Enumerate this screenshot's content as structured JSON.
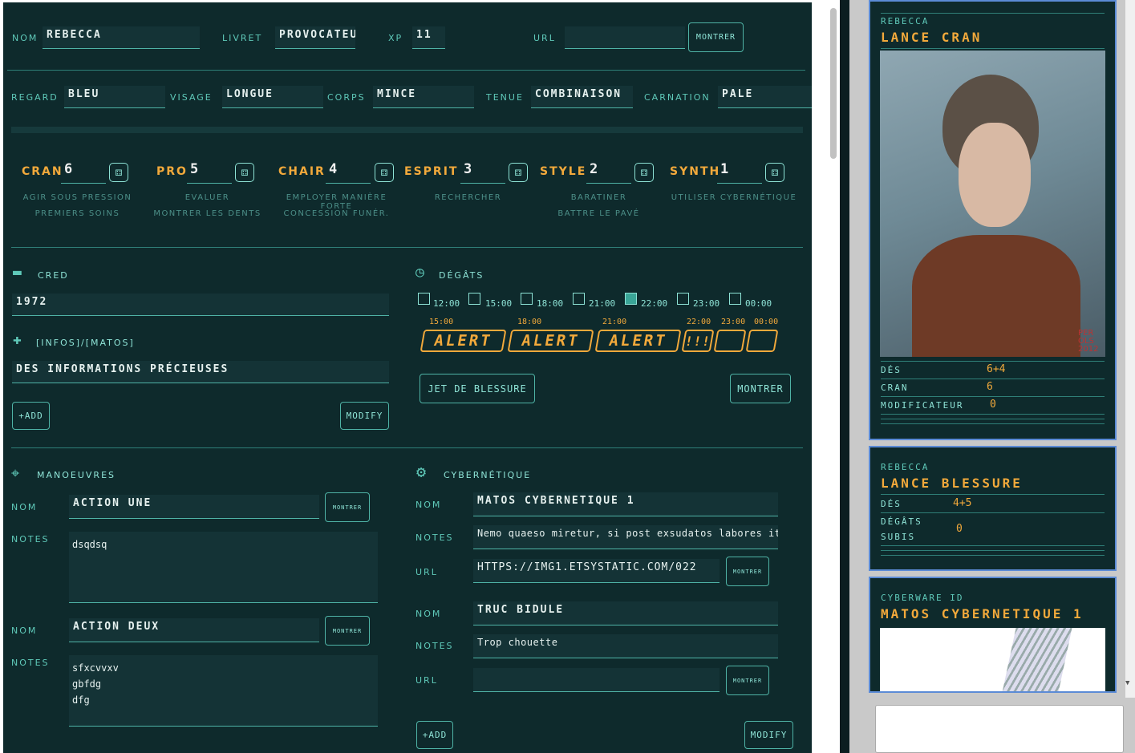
{
  "header": {
    "nom_label": "NOM",
    "nom": "REBECCA",
    "livret_label": "LIVRET",
    "livret": "PROVOCATEU",
    "xp_label": "XP",
    "xp": "11",
    "url_label": "URL",
    "url": "",
    "montrer": "MONTRER"
  },
  "look": {
    "regard_label": "REGARD",
    "regard": "BLEU",
    "visage_label": "VISAGE",
    "visage": "LONGUE",
    "corps_label": "CORPS",
    "corps": "MINCE",
    "tenue_label": "TENUE",
    "tenue": "COMBINAISON",
    "carnation_label": "CARNATION",
    "carnation": "PALE"
  },
  "stats": [
    {
      "name": "CRAN",
      "value": "6",
      "skills": [
        "AGIR SOUS PRESSION",
        "PREMIERS SOINS"
      ]
    },
    {
      "name": "PRO",
      "value": "5",
      "skills": [
        "EVALUER",
        "MONTRER LES DENTS"
      ]
    },
    {
      "name": "CHAIR",
      "value": "4",
      "skills": [
        "EMPLOYER MANIÈRE FORTE",
        "CONCESSION FUNÉR."
      ]
    },
    {
      "name": "ESPRIT",
      "value": "3",
      "skills": [
        "RECHERCHER",
        ""
      ]
    },
    {
      "name": "STYLE",
      "value": "2",
      "skills": [
        "BARATINER",
        "BATTRE LE PAVÉ"
      ]
    },
    {
      "name": "SYNTH",
      "value": "1",
      "skills": [
        "UTILISER CYBERNÉTIQUE",
        ""
      ]
    }
  ],
  "cred": {
    "title": "CRED",
    "value": "1972"
  },
  "infos": {
    "title": "[INFOS]/[MATOS]",
    "value": "DES INFORMATIONS PRÉCIEUSES",
    "add": "+ADD",
    "modify": "MODIFY"
  },
  "degats": {
    "title": "DÉGÂTS",
    "checks": [
      {
        "time": "12:00",
        "on": false
      },
      {
        "time": "15:00",
        "on": false
      },
      {
        "time": "18:00",
        "on": false
      },
      {
        "time": "21:00",
        "on": false
      },
      {
        "time": "22:00",
        "on": true
      },
      {
        "time": "23:00",
        "on": false
      },
      {
        "time": "00:00",
        "on": false
      }
    ],
    "alerts": [
      {
        "time": "15:00",
        "text": "ALERT"
      },
      {
        "time": "18:00",
        "text": "ALERT"
      },
      {
        "time": "21:00",
        "text": "ALERT"
      },
      {
        "time": "22:00",
        "text": "!!!"
      },
      {
        "time": "23:00",
        "text": ""
      },
      {
        "time": "00:00",
        "text": ""
      }
    ],
    "jet": "JET DE BLESSURE",
    "montrer": "MONTRER"
  },
  "manoeuvres": {
    "title": "MANOEUVRES",
    "nom_label": "NOM",
    "notes_label": "NOTES",
    "montrer": "MONTRER",
    "items": [
      {
        "nom": "ACTION UNE",
        "notes": "dsqdsq"
      },
      {
        "nom": "ACTION DEUX",
        "notes": "sfxcvvxv\ngbfdg\ndfg"
      }
    ]
  },
  "cyber": {
    "title": "CYBERNÉTIQUE",
    "nom_label": "NOM",
    "notes_label": "NOTES",
    "url_label": "URL",
    "montrer": "MONTRER",
    "add": "+ADD",
    "modify": "MODIFY",
    "items": [
      {
        "nom": "MATOS CYBERNETIQUE 1",
        "notes": "Nemo quaeso miretur, si post exsudatos labores iti",
        "url": "HTTPS://IMG1.ETSYSTATIC.COM/022"
      },
      {
        "nom": "TRUC BIDULE",
        "notes": "Trop chouette",
        "url": ""
      }
    ]
  },
  "chat": {
    "card1": {
      "who": "REBECCA",
      "title": "LANCE CRAN",
      "des_label": "DÉS",
      "des": "6+4",
      "cran_label": "CRAN",
      "cran": "6",
      "mod_label": "MODIFICATEUR",
      "mod": "0",
      "artist": "PER OLS 2012"
    },
    "card2": {
      "who": "REBECCA",
      "title": "LANCE BLESSURE",
      "des_label": "DÉS",
      "des": "4+5",
      "deg_label1": "DÉGÂTS",
      "deg_label2": "SUBIS",
      "deg": "0"
    },
    "card3": {
      "who": "CYBERWARE ID",
      "title": "MATOS CYBERNETIQUE 1"
    }
  },
  "colors": {
    "bg": "#0e2a2c",
    "accent": "#5fc9b9",
    "orange": "#f2a93b"
  }
}
